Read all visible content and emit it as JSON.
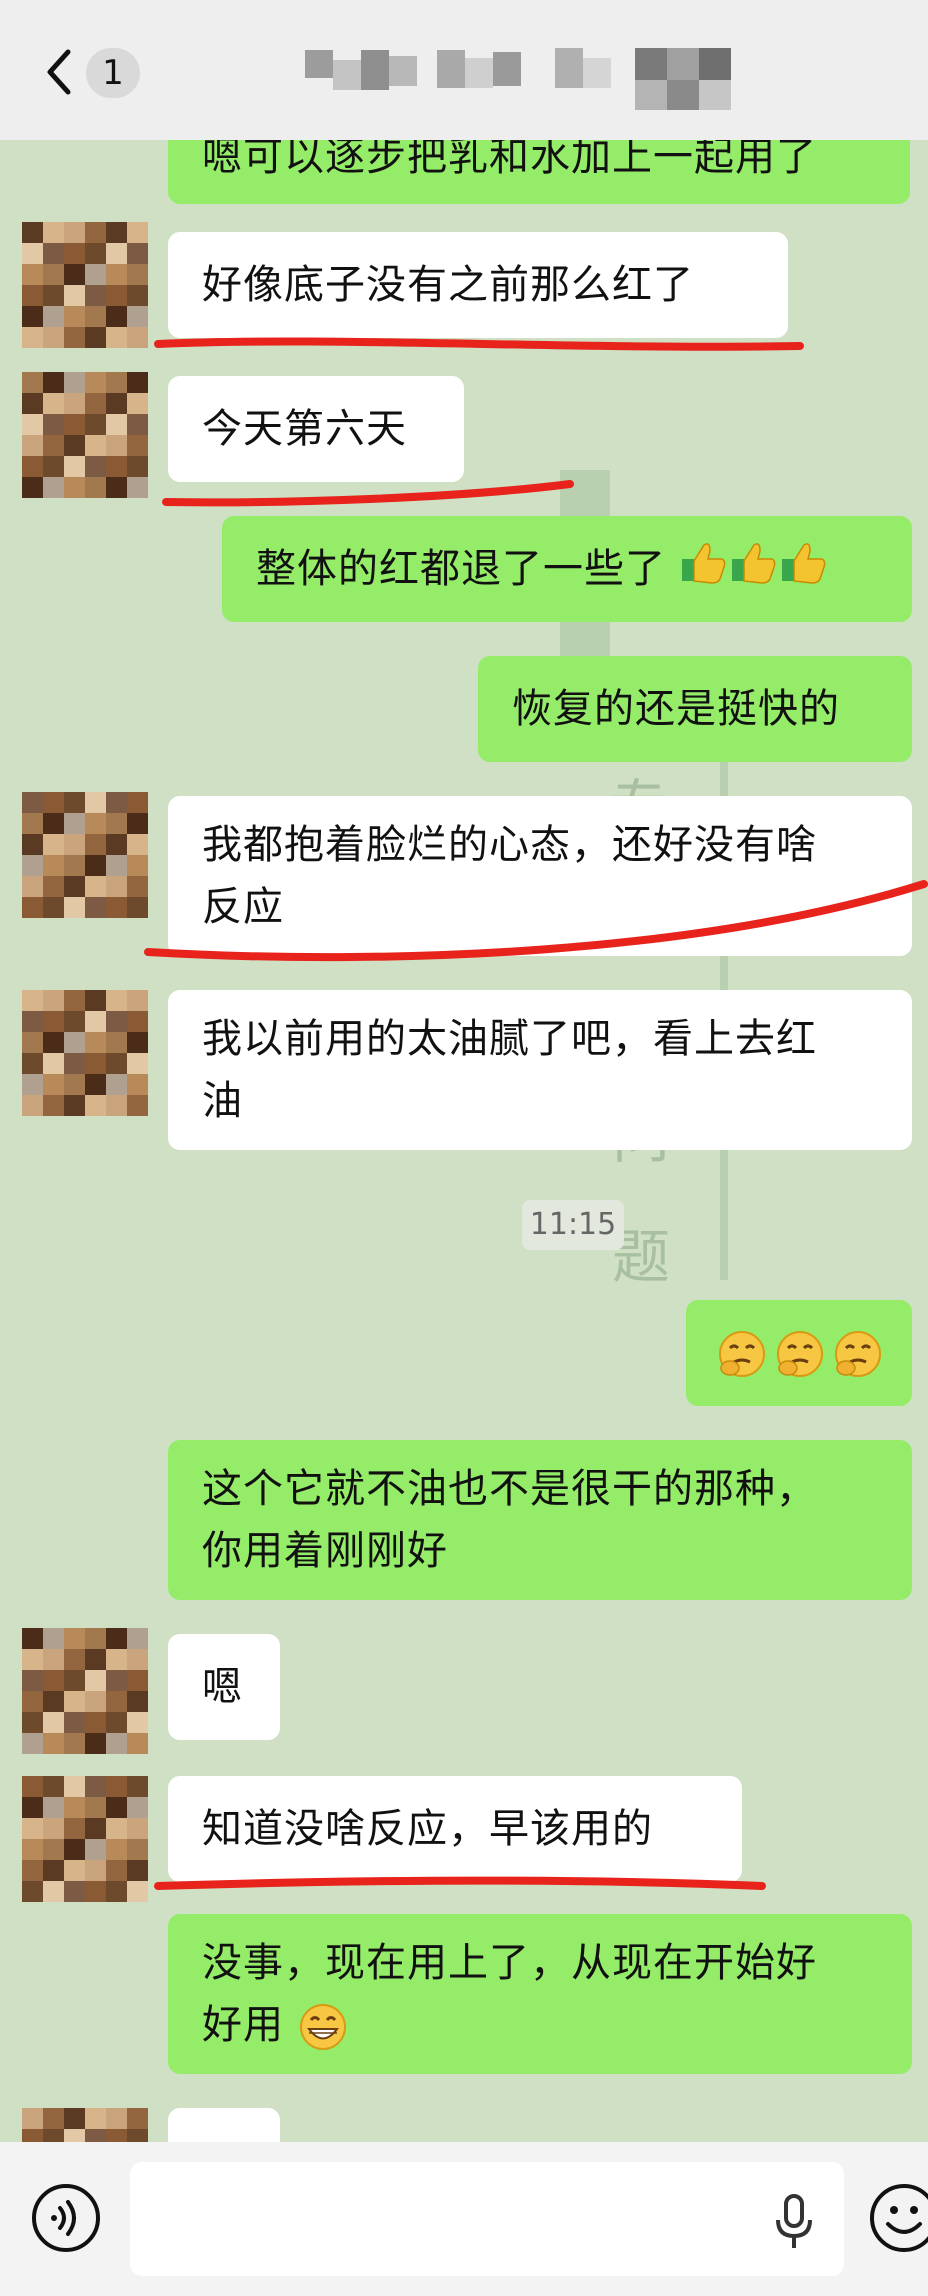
{
  "header": {
    "back_count": "1"
  },
  "messages": [
    {
      "id": "m0",
      "side": "right",
      "text": "嗯可以逐步把乳和水加上一起用了"
    },
    {
      "id": "m1",
      "side": "left",
      "text": "好像底子没有之前那么红了"
    },
    {
      "id": "m2",
      "side": "left",
      "text": "今天第六天"
    },
    {
      "id": "m3",
      "side": "right",
      "text": "整体的红都退了一些了"
    },
    {
      "id": "m4",
      "side": "right",
      "text": "恢复的还是挺快的"
    },
    {
      "id": "m5",
      "side": "left",
      "line1": "我都抱着脸烂的心态，还好没有啥",
      "line2": "反应"
    },
    {
      "id": "m6",
      "side": "left",
      "line1": "我以前用的太油腻了吧，看上去红",
      "line2": "油"
    },
    {
      "id": "m7",
      "side": "right",
      "text": ""
    },
    {
      "id": "m8",
      "side": "right",
      "line1": "这个它就不油也不是很干的那种，",
      "line2": "你用着刚刚好"
    },
    {
      "id": "m9",
      "side": "left",
      "text": "嗯"
    },
    {
      "id": "m10",
      "side": "left",
      "text": "知道没啥反应，早该用的"
    },
    {
      "id": "m11",
      "side": "right",
      "line1": "没事，现在用上了，从现在开始好",
      "line2": "好用"
    }
  ],
  "timestamp": "11:15",
  "icons": {
    "thumbs": "thumbs-up-icon",
    "think": "thinking-face-icon",
    "grin": "grinning-face-icon"
  },
  "colors": {
    "bubble_green": "#95ec69",
    "bubble_white": "#ffffff",
    "chat_bg": "#cfe0c4",
    "underline_red": "#e8231c"
  }
}
